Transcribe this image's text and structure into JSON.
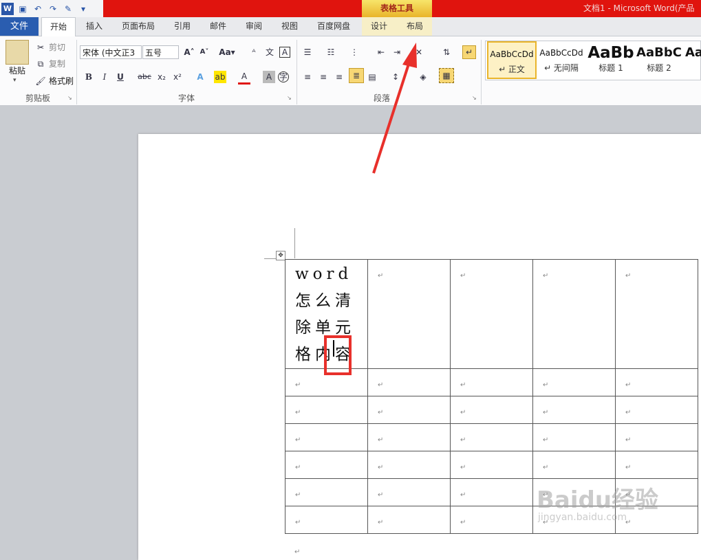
{
  "title_bar": {
    "context_group": "表格工具",
    "doc_title": "文档1 - Microsoft Word(产品"
  },
  "tabs": {
    "file": "文件",
    "home": "开始",
    "insert": "插入",
    "page_layout": "页面布局",
    "references": "引用",
    "mailings": "邮件",
    "review": "审阅",
    "view": "视图",
    "baidu": "百度网盘",
    "design": "设计",
    "layout": "布局"
  },
  "clipboard": {
    "paste": "粘贴",
    "cut": "剪切",
    "copy": "复制",
    "format_painter": "格式刷",
    "label": "剪贴板"
  },
  "font": {
    "font_name": "宋体 (中文正3",
    "font_size": "五号",
    "label": "字体"
  },
  "paragraph": {
    "label": "段落"
  },
  "styles": [
    {
      "sample": "AaBbCcDd",
      "label": "↵ 正文"
    },
    {
      "sample": "AaBbCcDd",
      "label": "↵ 无间隔"
    },
    {
      "sample": "AaBb",
      "label": "标题 1"
    },
    {
      "sample": "AaBbC",
      "label": "标题 2"
    },
    {
      "sample": "Aa",
      "label": ""
    }
  ],
  "document": {
    "cell_text": "word 怎么清除单元格内容",
    "paragraph_mark": "↵"
  },
  "watermark": {
    "logo": "Baidu经验",
    "url": "jingyan.baidu.com"
  },
  "colors": {
    "title_red": "#e0140e",
    "file_blue": "#2a5db0",
    "highlight_red": "#e8302b"
  }
}
